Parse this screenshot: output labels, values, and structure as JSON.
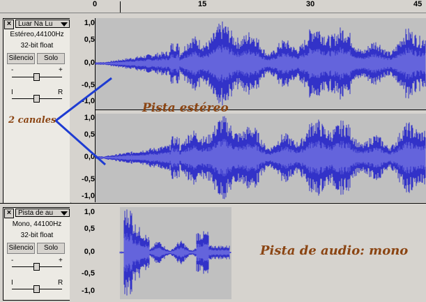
{
  "ruler": {
    "ticks": [
      "0",
      "15",
      "30",
      "45"
    ]
  },
  "stereo_track": {
    "name": "Luar Na Lu",
    "format": "Estéreo,44100Hz",
    "bitdepth": "32-bit float",
    "mute_label": "Silencio",
    "solo_label": "Solo",
    "gain_minus": "-",
    "gain_plus": "+",
    "pan_left": "I",
    "pan_right": "R",
    "scale_top": [
      "1,0",
      "0,5",
      "0,0",
      "-0,5",
      "-1,0"
    ],
    "scale_bottom": [
      "1,0",
      "0,5",
      "0,0",
      "-0,5",
      "-1,0"
    ]
  },
  "mono_track": {
    "name": "Pista de au",
    "format": "Mono, 44100Hz",
    "bitdepth": "32-bit float",
    "mute_label": "Silencio",
    "solo_label": "Solo",
    "gain_minus": "-",
    "gain_plus": "+",
    "pan_left": "I",
    "pan_right": "R",
    "scale": [
      "1,0",
      "0,5",
      "0,0",
      "-0,5",
      "-1,0"
    ]
  },
  "annotations": {
    "channels": "2 canales",
    "stereo": "Pista estéreo",
    "mono": "Pista de audio: mono"
  },
  "colors": {
    "waveform": "#3232c8",
    "waveform_light": "#6464dc",
    "annotation": "#8b4513",
    "pointer": "#1e3cd2"
  }
}
